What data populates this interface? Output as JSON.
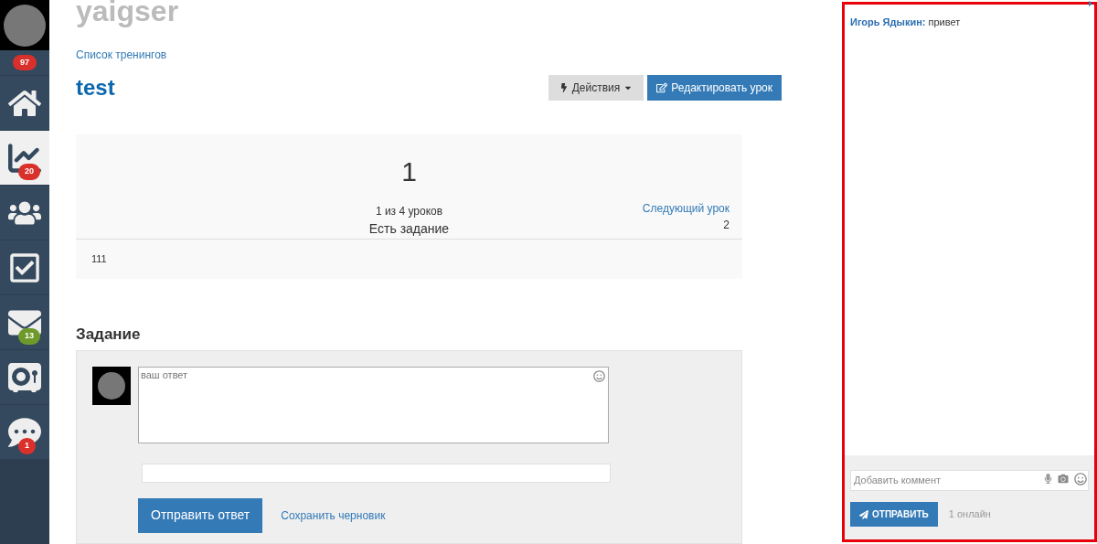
{
  "sidebar": {
    "top_badge": {
      "count": "97",
      "color": "#d9302c"
    },
    "items": [
      {
        "kind": "home",
        "selected": false
      },
      {
        "kind": "chart",
        "selected": true,
        "badge": "20",
        "color": "#d9302c"
      },
      {
        "kind": "users",
        "selected": false
      },
      {
        "kind": "tasks",
        "selected": false
      },
      {
        "kind": "mail",
        "selected": false,
        "badge": "13",
        "color": "#6e9a2c"
      },
      {
        "kind": "safe",
        "selected": false
      },
      {
        "kind": "chat",
        "selected": false,
        "badge": "1",
        "color": "#d9302c"
      }
    ]
  },
  "header": {
    "site_title": "yaigser",
    "breadcrumb": "Список тренингов",
    "title": "test",
    "actions_button": "Действия",
    "edit_button": "Редактировать урок"
  },
  "lesson": {
    "number": "1",
    "progress": "1 из 4 уроков",
    "has_task": "Есть задание",
    "next_link": "Следующий урок",
    "next_number": "2",
    "content": "111"
  },
  "task": {
    "heading": "Задание",
    "answer": {
      "placeholder": "ваш ответ"
    },
    "submit_button": "Отправить ответ",
    "draft_link": "Сохранить черновик"
  },
  "chat": {
    "messages": [
      {
        "author": "Игорь Ядыкин:",
        "text": "привет"
      }
    ],
    "comment": {
      "placeholder": "Добавить коммент"
    },
    "send_button": "ОТПРАВИТЬ",
    "online": "1 онлайн"
  }
}
